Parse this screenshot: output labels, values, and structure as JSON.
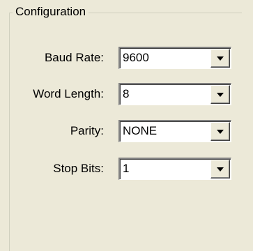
{
  "groupbox": {
    "title": "Configuration"
  },
  "fields": [
    {
      "label": "Baud Rate:",
      "value": "9600",
      "icon": "chevron-down-icon"
    },
    {
      "label": "Word Length:",
      "value": "8",
      "icon": "chevron-down-icon"
    },
    {
      "label": "Parity:",
      "value": "NONE",
      "icon": "chevron-down-icon"
    },
    {
      "label": "Stop Bits:",
      "value": "1",
      "icon": "chevron-down-icon"
    }
  ],
  "colors": {
    "background": "#ece9d8",
    "field_background": "#ffffff",
    "text": "#000000"
  }
}
